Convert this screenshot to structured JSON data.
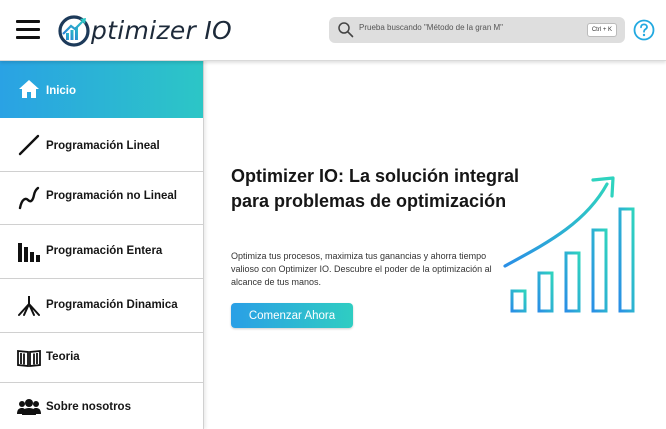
{
  "header": {
    "logo_text": "ptimizer IO",
    "search_placeholder": "Prueba buscando \"Método de la gran M\"",
    "search_shortcut": "Ctrl + K"
  },
  "sidebar": {
    "items": [
      {
        "label": "Inicio",
        "icon": "home-icon",
        "active": true
      },
      {
        "label": "Programación Lineal",
        "icon": "line-icon",
        "active": false
      },
      {
        "label": "Programación no Lineal",
        "icon": "curve-icon",
        "active": false
      },
      {
        "label": "Programación Entera",
        "icon": "bar-chart-icon",
        "active": false
      },
      {
        "label": "Programación Dinamica",
        "icon": "tree-icon",
        "active": false
      },
      {
        "label": "Teoria",
        "icon": "book-icon",
        "active": false
      },
      {
        "label": "Sobre nosotros",
        "icon": "users-icon",
        "active": false
      }
    ]
  },
  "hero": {
    "title": "Optimizer IO: La solución integral para problemas de optimización",
    "description": "Optimiza tus procesos, maximiza tus ganancias y ahorra tiempo valioso con Optimizer IO. Descubre el poder de la optimización al alcance de tus manos.",
    "cta_label": "Comenzar Ahora"
  },
  "colors": {
    "accent_start": "#2aa2e4",
    "accent_end": "#2cc6c6"
  }
}
